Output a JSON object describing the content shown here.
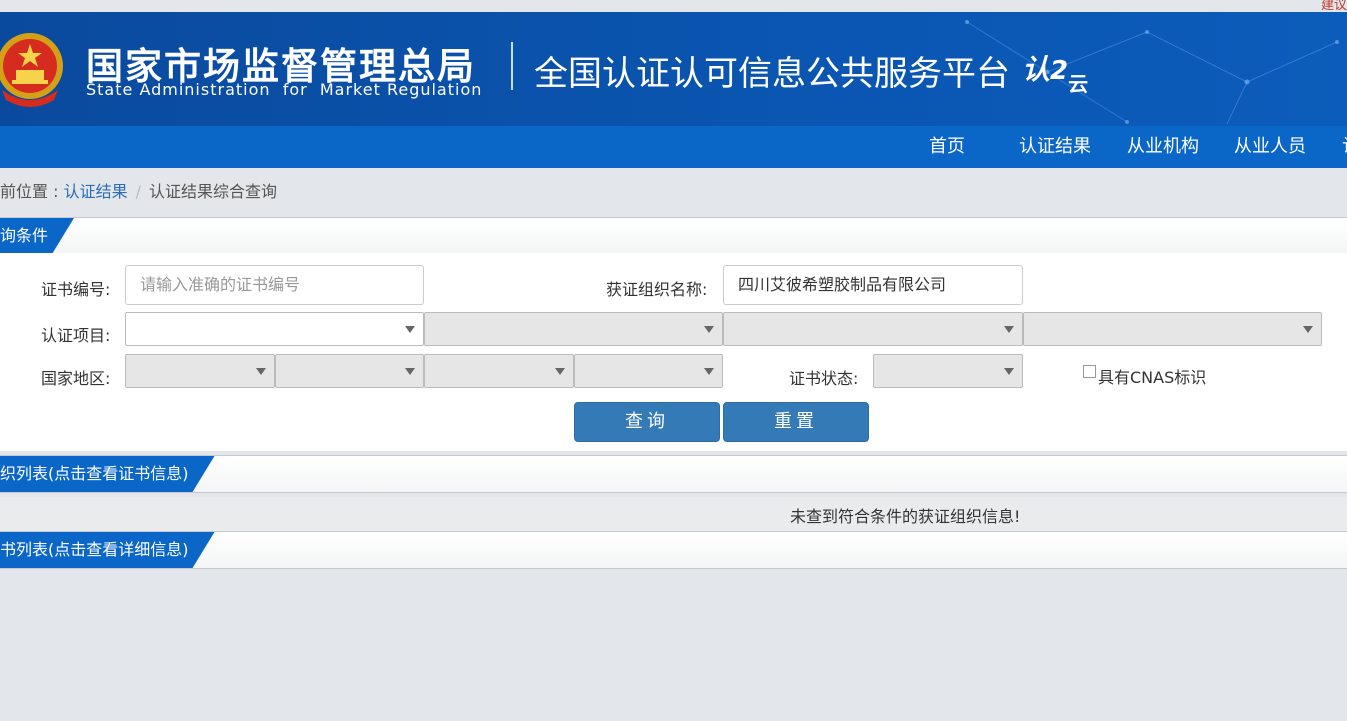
{
  "top": {
    "link": "建议"
  },
  "header": {
    "org_cn": "国家市场监督管理总局",
    "org_en": "State Administration  for  Market Regulation",
    "platform": "全国认证认可信息公共服务平台",
    "logo_main": "认",
    "logo_sub": "云"
  },
  "nav": {
    "items": [
      {
        "label": "首页"
      },
      {
        "label": "认证结果"
      },
      {
        "label": "从业机构"
      },
      {
        "label": "从业人员"
      },
      {
        "label": "认"
      }
    ]
  },
  "breadcrumb": {
    "prefix": "前位置 : ",
    "link": "认证结果",
    "separator": "/",
    "current": "认证结果综合查询"
  },
  "search_section": {
    "title": "询条件"
  },
  "form": {
    "cert_no_label": "证书编号:",
    "cert_no_placeholder": "请输入准确的证书编号",
    "org_name_label": "获证组织名称:",
    "org_name_value": "四川艾彼希塑胶制品有限公司",
    "project_label": "认证项目:",
    "region_label": "国家地区:",
    "status_label": "证书状态:",
    "cnas_label": "具有CNAS标识",
    "cnas_checked": false
  },
  "buttons": {
    "query": "查询",
    "reset": "重置"
  },
  "org_list_section": {
    "title": "织列表(点击查看证书信息)"
  },
  "empty_message": "未查到符合条件的获证组织信息!",
  "cert_list_section": {
    "title": "书列表(点击查看详细信息)"
  },
  "colors": {
    "header_blue": "#0a55b0",
    "nav_blue": "#0a67c8",
    "button_blue": "#337ab7"
  }
}
